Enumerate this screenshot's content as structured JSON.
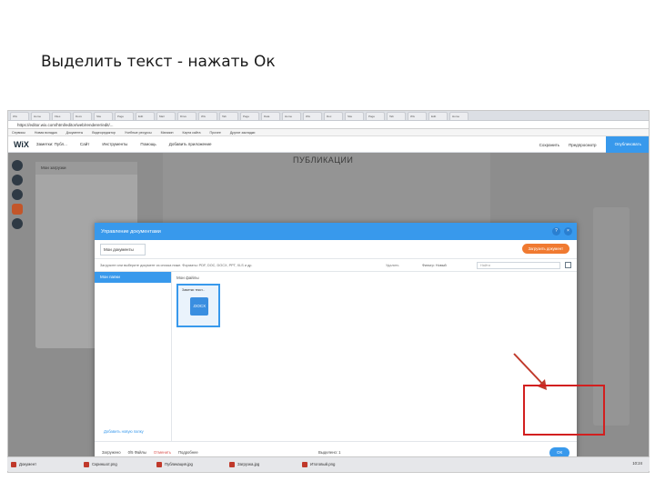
{
  "slide": {
    "title": "Выделить текст - нажать Ок"
  },
  "browser": {
    "tabs": [
      "Wix",
      "Home",
      "Files",
      "Docs",
      "Site",
      "Page",
      "Edit",
      "Mail",
      "Drive",
      "Wix",
      "Tab",
      "Page",
      "Data",
      "Home",
      "Wix",
      "Doc",
      "Site",
      "Page",
      "Tab",
      "Wix",
      "Edit",
      "Home"
    ],
    "address": "https://editor.wix.com/html/editor/web/renderer/edit/...",
    "bookmarks": [
      "Сервисы",
      "Новая вкладка",
      "Документы",
      "Видеоредактор",
      "Учебные ресурсы",
      "Магазин",
      "Карта сайта",
      "Прочее",
      "Другие закладки"
    ]
  },
  "wix_topbar": {
    "logo": "WiX",
    "site_name": "Заметки: Публ...",
    "menu": [
      "Сайт",
      "Инструменты",
      "Помощь",
      "Добавить приложение"
    ],
    "right": [
      "Сохранить",
      "Предпросмотр"
    ],
    "publish_label": "Опубликовать"
  },
  "editor": {
    "page_heading": "ПУБЛИКАЦИИ",
    "behind_panel_title": "Мои загрузки"
  },
  "modal": {
    "title": "Управление документами",
    "tab_label": "Мои документы",
    "upload_button": "Загрузить документ",
    "toolbar_hint": "Загрузите или выберите документ из списка ниже. Форматы: PDF, DOC, DOCX, PPT, XLS и др.",
    "delete_label": "Удалить",
    "filter_label": "Фильтр: Новый",
    "search_placeholder": "Найти",
    "sidebar_item": "Мои папки",
    "new_folder_label": "Добавить новую папку",
    "area_title": "Мои файлы",
    "file_name": "Заметки текст...",
    "file_ext": ".DOCX",
    "footer_uploads": "Загружено",
    "footer_count": "0/5 Файлы",
    "footer_warning": "Отменить",
    "footer_more": "Подробнее",
    "footer_selected": "Выделено: 1",
    "ok_label": "ОК"
  },
  "taskbar": {
    "items": [
      "Документ",
      "Скриншот.png",
      "Публикация.jpg",
      "Загрузка.jpg",
      "Итоговый.png"
    ],
    "clock": "10:24"
  },
  "annotation": {
    "highlight_color": "#d21f1f"
  },
  "colors": {
    "accent": "#3899ec",
    "upload": "#f07a31"
  }
}
